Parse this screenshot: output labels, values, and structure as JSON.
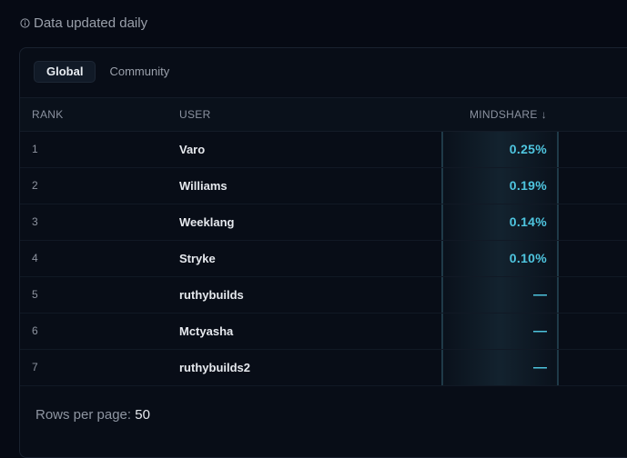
{
  "notice": {
    "icon": "info-icon",
    "text": "Data updated daily"
  },
  "tabs": [
    {
      "label": "Global",
      "active": true
    },
    {
      "label": "Community",
      "active": false
    }
  ],
  "table": {
    "columns": {
      "rank": "RANK",
      "user": "USER",
      "mindshare": "MINDSHARE",
      "sort_icon": "↓"
    },
    "rows": [
      {
        "rank": "1",
        "user": "Varo",
        "mindshare": "0.25%"
      },
      {
        "rank": "2",
        "user": "Williams",
        "mindshare": "0.19%"
      },
      {
        "rank": "3",
        "user": "Weeklang",
        "mindshare": "0.14%"
      },
      {
        "rank": "4",
        "user": "Stryke",
        "mindshare": "0.10%"
      },
      {
        "rank": "5",
        "user": "ruthybuilds",
        "mindshare": "—"
      },
      {
        "rank": "6",
        "user": "Mctyasha",
        "mindshare": "—"
      },
      {
        "rank": "7",
        "user": "ruthybuilds2",
        "mindshare": "—"
      }
    ]
  },
  "footer": {
    "rows_per_page_label": "Rows per page:",
    "rows_per_page_value": "50"
  },
  "colors": {
    "background": "#060a14",
    "accent": "#4fc6e0",
    "highlight_border": "#1f3a48"
  }
}
